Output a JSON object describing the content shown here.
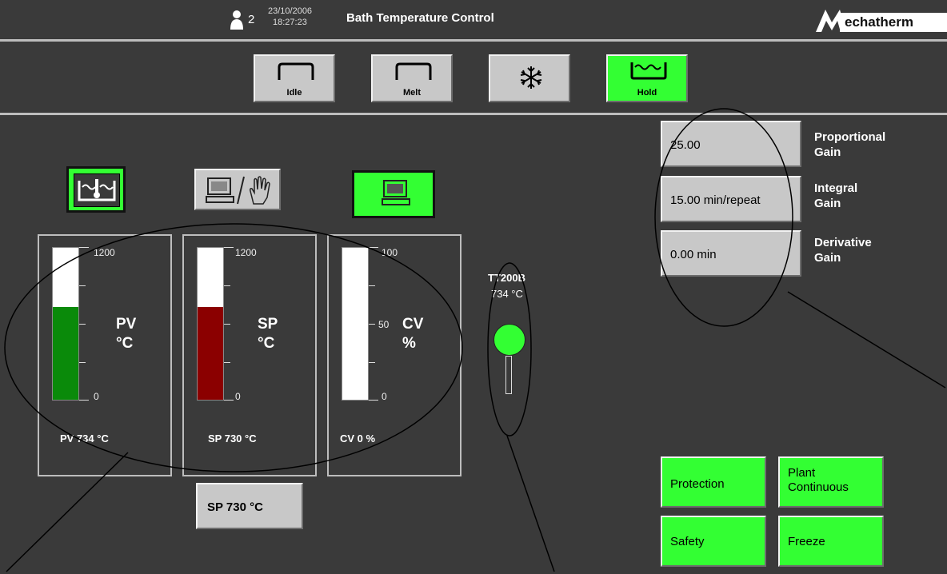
{
  "header": {
    "user_count": "2",
    "date": "23/10/2006",
    "time": "18:27:23",
    "title": "Bath Temperature Control",
    "logo_text": "echatherm"
  },
  "modes": [
    {
      "label": "Idle",
      "icon": "empty-bath-icon",
      "active": false
    },
    {
      "label": "Melt",
      "icon": "empty-bath-icon",
      "active": false
    },
    {
      "label": "",
      "icon": "snowflake-icon",
      "active": false
    },
    {
      "label": "Hold",
      "icon": "filled-bath-icon",
      "active": true
    }
  ],
  "pid": {
    "proportional": {
      "value": "25.00",
      "label_line1": "Proportional",
      "label_line2": "Gain"
    },
    "integral": {
      "value": "15.00 min/repeat",
      "label_line1": "Integral",
      "label_line2": "Gain"
    },
    "derivative": {
      "value": "0.00 min",
      "label_line1": "Derivative",
      "label_line2": "Gain"
    }
  },
  "gauges": {
    "pv": {
      "max": "1200",
      "min": "0",
      "name": "PV",
      "unit": "°C",
      "readout": "PV 734 °C",
      "level": 0.61,
      "color": "#0a8a0a"
    },
    "sp": {
      "max": "1200",
      "min": "0",
      "name": "SP",
      "unit": "°C",
      "readout": "SP 730 °C",
      "level": 0.61,
      "color": "#8b0000"
    },
    "cv": {
      "max": "100",
      "mid": "50",
      "min": "0",
      "name": "CV",
      "unit": "%",
      "readout": "CV 0 %",
      "level": 0.0,
      "color": "#ffffff"
    }
  },
  "sp_button": "SP 730 °C",
  "sensor": {
    "tag": "TT200B",
    "value": "734 °C",
    "color": "#33ff33"
  },
  "status": {
    "protection": "Protection",
    "plant_line1": "Plant",
    "plant_line2": "Continuous",
    "safety": "Safety",
    "freeze": "Freeze"
  },
  "colors": {
    "active_green": "#33ff33",
    "background": "#3a3a3a",
    "button_grey": "#c8c8c8"
  }
}
